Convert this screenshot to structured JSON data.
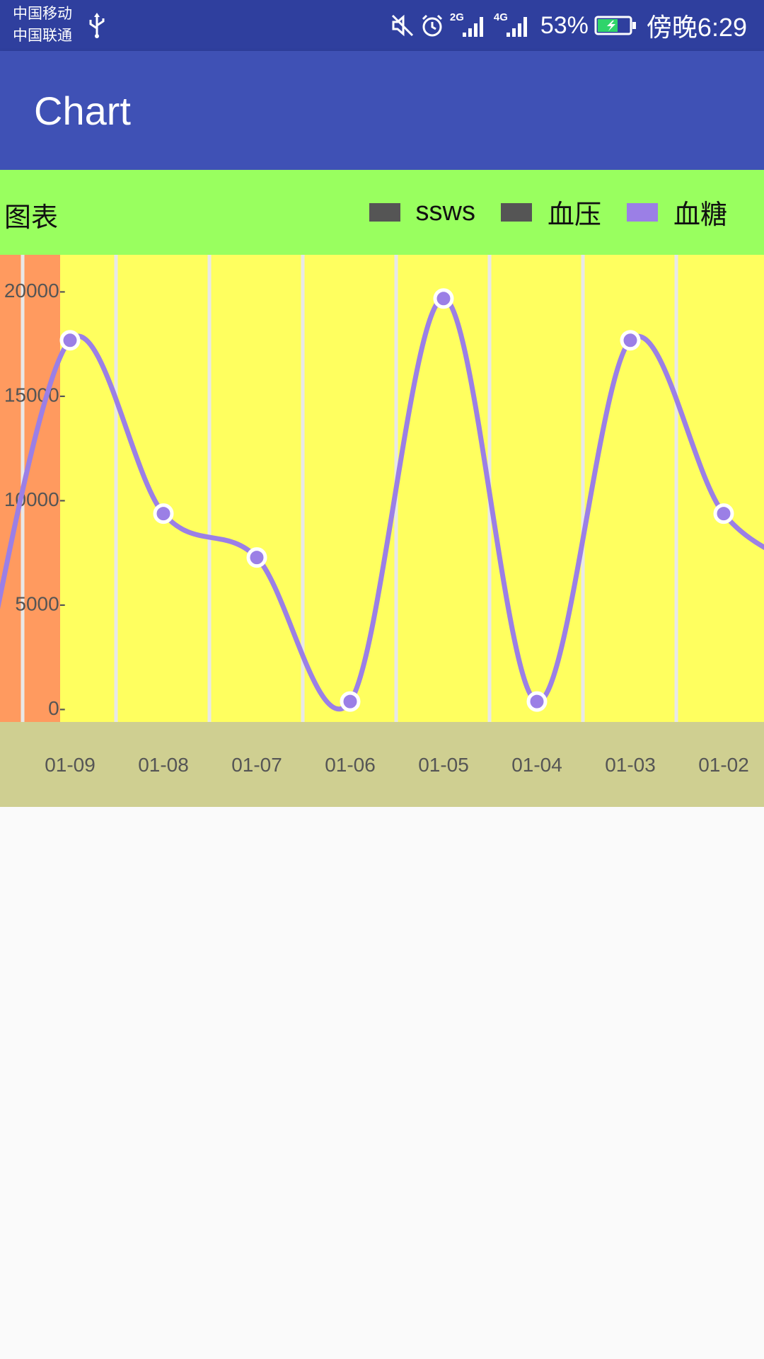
{
  "status_bar": {
    "carrier_1": "中国移动",
    "carrier_2": "中国联通",
    "signal_1_label": "2G",
    "signal_2_label": "4G",
    "battery_percent": "53%",
    "time": "傍晚6:29",
    "icons": [
      "usb-icon",
      "mute-icon",
      "alarm-icon",
      "signal-icon",
      "signal-icon",
      "battery-icon"
    ]
  },
  "app_bar": {
    "title": "Chart"
  },
  "chart_data": {
    "type": "line",
    "title": "图表",
    "categories": [
      "01-09",
      "01-08",
      "01-07",
      "01-06",
      "01-05",
      "01-04",
      "01-03",
      "01-02"
    ],
    "series": [
      {
        "name": "血糖",
        "color": "#9b7fe6",
        "values": [
          17600,
          9300,
          7200,
          300,
          19600,
          300,
          17600,
          9300
        ]
      }
    ],
    "legend": [
      {
        "name": "ssws",
        "color": "#555555"
      },
      {
        "name": "血压",
        "color": "#555555"
      },
      {
        "name": "血糖",
        "color": "#9b7fe6"
      }
    ],
    "y_ticks": [
      "0-",
      "5000-",
      "10000-",
      "15000-",
      "20000-"
    ],
    "ylim": [
      0,
      20000
    ],
    "grid": true,
    "legend_position": "top-right",
    "colors": {
      "header_bg": "#99ff5f",
      "plot_bg": "#ffff5f",
      "highlight_bg": "#ff9a5f",
      "xaxis_bg": "#cfcf91",
      "grid": "#e8e8e8"
    }
  }
}
